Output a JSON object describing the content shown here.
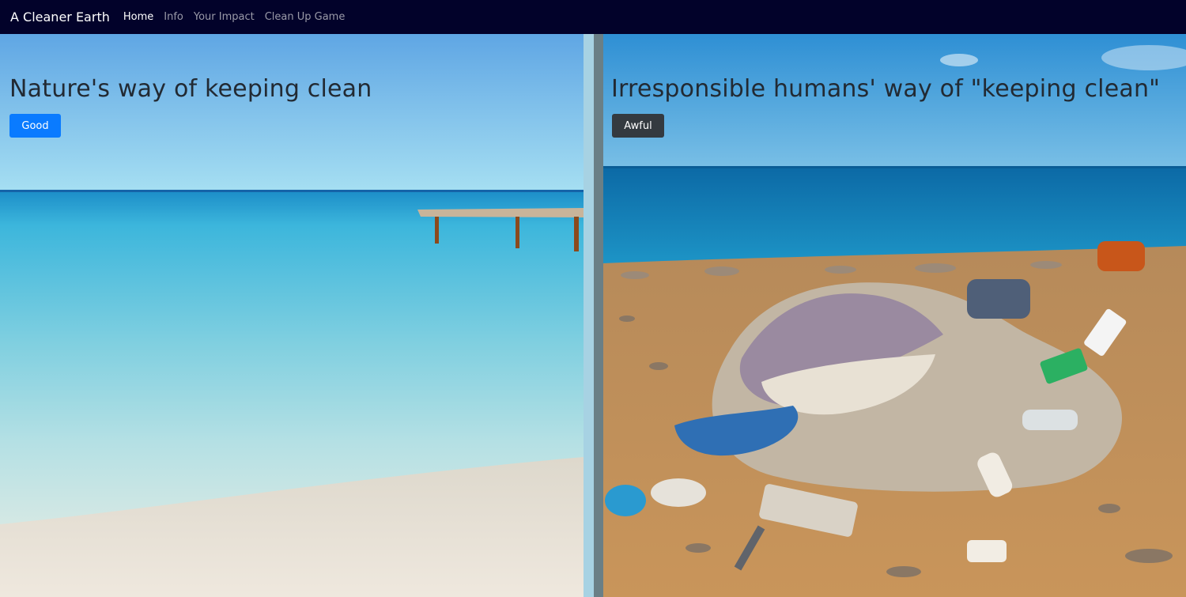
{
  "navbar": {
    "brand": "A Cleaner Earth",
    "links": [
      {
        "label": "Home",
        "active": true
      },
      {
        "label": "Info",
        "active": false
      },
      {
        "label": "Your Impact",
        "active": false
      },
      {
        "label": "Clean Up Game",
        "active": false
      }
    ]
  },
  "left_panel": {
    "title": "Nature's way of keeping clean",
    "button_label": "Good",
    "button_color": "#0a7bff",
    "image": "clean-beach-photo"
  },
  "right_panel": {
    "title": "Irresponsible humans' way of \"keeping clean\"",
    "button_label": "Awful",
    "button_color": "#343a40",
    "image": "polluted-beach-photo"
  },
  "colors": {
    "navbar_bg": "#02022a",
    "heading_text": "#222a33"
  }
}
